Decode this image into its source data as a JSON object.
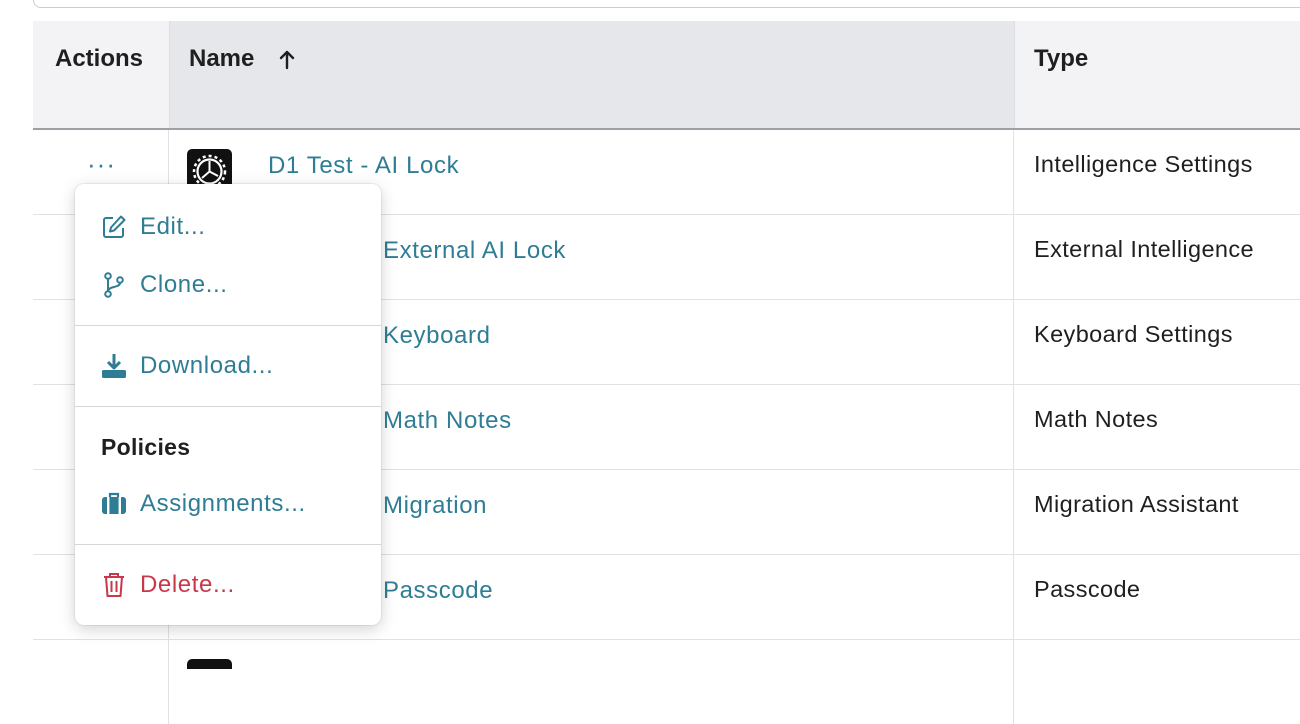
{
  "table": {
    "headers": {
      "actions": "Actions",
      "name": "Name",
      "type": "Type"
    },
    "rows": [
      {
        "name": "D1 Test - AI Lock",
        "type": "Intelligence Settings"
      },
      {
        "name": "External AI Lock",
        "type": "External Intelligence"
      },
      {
        "name": "Keyboard",
        "type": "Keyboard Settings"
      },
      {
        "name": "Math Notes",
        "type": "Math Notes"
      },
      {
        "name": "Migration",
        "type": "Migration Assistant"
      },
      {
        "name": "Passcode",
        "type": "Passcode"
      }
    ],
    "more_label": "···"
  },
  "context_menu": {
    "edit": "Edit...",
    "clone": "Clone...",
    "download": "Download...",
    "section_title": "Policies",
    "assignments": "Assignments...",
    "delete": "Delete..."
  },
  "icons": {
    "sort": "arrow-up-icon",
    "edit": "edit-icon",
    "clone": "branch-icon",
    "download": "download-icon",
    "assignments": "briefcase-icon",
    "delete": "trash-icon",
    "row": "settings-gear-icon"
  },
  "colors": {
    "link": "#2f7d95",
    "danger": "#c8374a",
    "header_bg": "#f3f3f5",
    "sorted_header_bg": "#e6e7ea"
  }
}
